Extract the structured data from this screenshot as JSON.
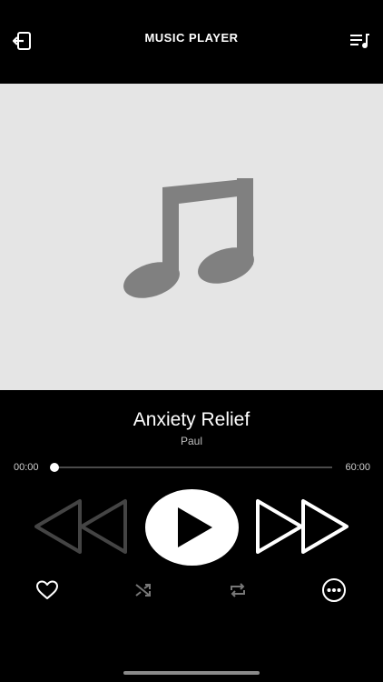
{
  "header": {
    "title": "MUSIC PLAYER",
    "left_icon": "exit-icon",
    "right_icon": "playlist-icon"
  },
  "artwork": {
    "icon": "music-note-icon"
  },
  "track": {
    "title": "Anxiety Relief",
    "artist": "Paul"
  },
  "progress": {
    "current": "00:00",
    "total": "60:00",
    "fraction": 0.0
  },
  "controls": {
    "rewind_icon": "rewind-icon",
    "play_icon": "play-icon",
    "forward_icon": "fast-forward-icon"
  },
  "actions": {
    "like_icon": "heart-icon",
    "shuffle_icon": "shuffle-icon",
    "repeat_icon": "repeat-icon",
    "more_icon": "more-icon"
  },
  "colors": {
    "background": "#000000",
    "artwork_bg": "#e5e5e5",
    "note": "#808080"
  }
}
